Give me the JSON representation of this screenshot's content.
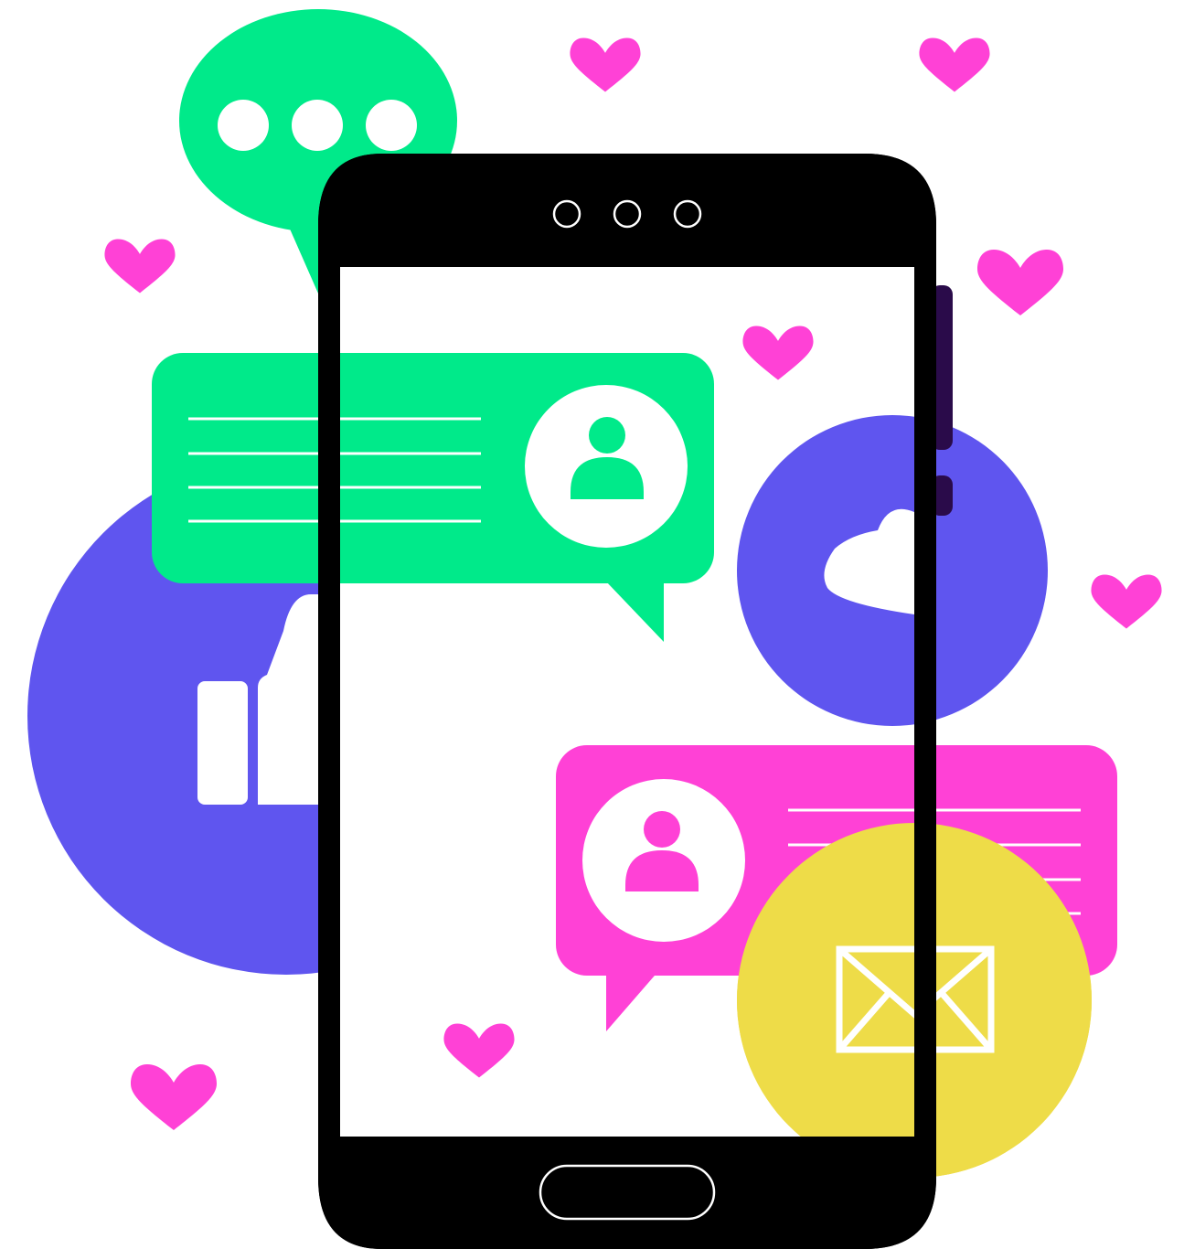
{
  "illustration": {
    "background": "#ffffff"
  },
  "palette": {
    "green": "#00EA8A",
    "blue": "#5F55EF",
    "pink": "#FF41D6",
    "yellow": "#EEDC48",
    "phone_body": "#000000",
    "phone_screen": "#ffffff",
    "white": "#ffffff",
    "side_button": "#2A0B4A"
  },
  "icons": [
    "heart-icon",
    "thumbs-up-icon",
    "user-icon",
    "envelope-icon",
    "typing-dots-icon",
    "camera-dots-icon",
    "home-button-icon"
  ]
}
